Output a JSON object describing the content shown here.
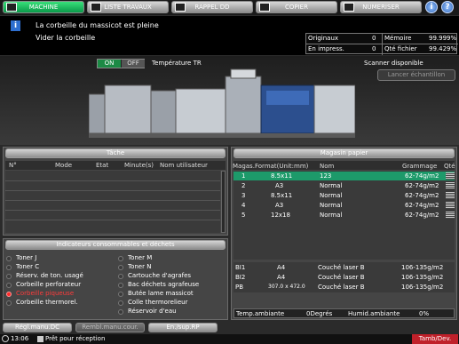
{
  "tabs": [
    {
      "label": "MACHINE",
      "icon": "machine-icon",
      "active": true
    },
    {
      "label": "LISTE TRAVAUX",
      "icon": "job-list-icon"
    },
    {
      "label": "RAPPEL DD",
      "icon": "hdd-recall-icon"
    },
    {
      "label": "COPIER",
      "icon": "copier-icon"
    },
    {
      "label": "NUMERISER",
      "icon": "scan-icon"
    }
  ],
  "message": {
    "line1": "La corbeille du massicot est pleine",
    "line2": "Vider la corbeille"
  },
  "counter": {
    "originals_label": "Originaux",
    "originals_value": "0",
    "memory_label": "Mémoire",
    "memory_value": "99.999%",
    "printing_label": "En impress.",
    "printing_value": "0",
    "hdd_label": "Qté fichier",
    "hdd_value": "99.429%"
  },
  "toggle": {
    "on": "ON",
    "off": "OFF",
    "label": "Température TR"
  },
  "scanner": {
    "status": "Scanner disponible",
    "sample_button": "Lancer échantillon"
  },
  "tasks": {
    "title": "Tâche",
    "columns": [
      "N°",
      "Mode",
      "Etat",
      "Minute(s)",
      "Nom utilisateur"
    ]
  },
  "consumables": {
    "title": "Indicateurs consommables et déchets",
    "items": [
      {
        "label": "Toner J",
        "icon": "toner-icon",
        "alert": false
      },
      {
        "label": "Toner C",
        "icon": "toner-icon",
        "alert": false
      },
      {
        "label": "Réserv. de ton. usagé",
        "icon": "waste-toner-icon",
        "alert": false
      },
      {
        "label": "Corbeille perforateur",
        "icon": "punch-trash-icon",
        "alert": false
      },
      {
        "label": "Corbeille piqueuse",
        "icon": "stapler-trash-icon",
        "alert": true
      },
      {
        "label": "Corbeille thermorel.",
        "icon": "thermal-trash-icon",
        "alert": false
      },
      {
        "label": "Toner M",
        "icon": "toner-icon",
        "alert": false
      },
      {
        "label": "Toner N",
        "icon": "toner-icon",
        "alert": false
      },
      {
        "label": "Cartouche d'agrafes",
        "icon": "staple-cartridge-icon",
        "alert": false
      },
      {
        "label": "Bac déchets agrafeuse",
        "icon": "staple-waste-icon",
        "alert": false
      },
      {
        "label": "Butée lame massicot",
        "icon": "trimmer-blade-icon",
        "alert": false
      },
      {
        "label": "Colle thermorelieur",
        "icon": "glue-icon",
        "alert": false
      },
      {
        "label": "Réservoir d'eau",
        "icon": "water-tank-icon",
        "alert": false
      }
    ]
  },
  "paper": {
    "title": "Magasin papier",
    "columns": [
      "Magas.",
      "Format(Unit:mm)",
      "Nom",
      "Grammage",
      "Qté"
    ],
    "rows": [
      {
        "tray": "1",
        "format": "8.5x11",
        "name": "123",
        "weight": "62-74g/m2",
        "selected": true
      },
      {
        "tray": "2",
        "format": "A3",
        "name": "Normal",
        "weight": "62-74g/m2"
      },
      {
        "tray": "3",
        "format": "8.5x11",
        "name": "Normal",
        "weight": "62-74g/m2"
      },
      {
        "tray": "4",
        "format": "A3",
        "name": "Normal",
        "weight": "62-74g/m2"
      },
      {
        "tray": "5",
        "format": "12x18",
        "name": "Normal",
        "weight": "62-74g/m2"
      }
    ],
    "inserter_rows": [
      {
        "tray": "BI1",
        "format": "A4",
        "name": "Couché laser B",
        "weight": "106-135g/m2"
      },
      {
        "tray": "BI2",
        "format": "A4",
        "name": "Couché laser B",
        "weight": "106-135g/m2"
      },
      {
        "tray": "PB",
        "format": "307.0 x 472.0",
        "name": "Couché laser B",
        "weight": "106-135g/m2"
      }
    ],
    "temp_label": "Temp.ambiante",
    "temp_value": "0Degrés",
    "humidity_label": "Humid.ambiante",
    "humidity_value": "0%"
  },
  "bottom_buttons": {
    "manual_dc": "Régl.manu.DC",
    "manual_rp": "Rembl.manu.cour.",
    "sup_rp": "En./sup.RP"
  },
  "status_bar": {
    "time": "13:06",
    "status": "Prêt pour réception",
    "badge": "Tamb/Dev."
  },
  "colors": {
    "active_tab": "#17b35a",
    "alert": "#ff2a2a",
    "selected_row": "#1d9a6a",
    "info": "#2e6fd0"
  }
}
